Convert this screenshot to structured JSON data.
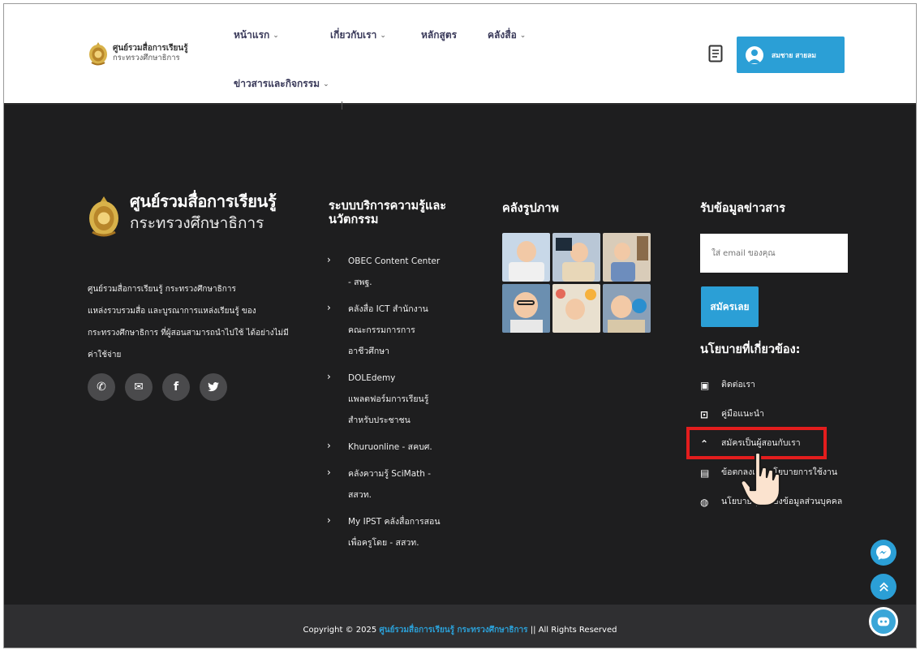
{
  "header": {
    "logo_title": "ศูนย์รวมสื่อการเรียนรู้",
    "logo_sub": "กระทรวงศึกษาธิการ",
    "nav": [
      {
        "label": "หน้าแรก",
        "has_dropdown": true
      },
      {
        "label": "เกี่ยวกับเรา",
        "has_dropdown": true
      },
      {
        "label": "หลักสูตร",
        "has_dropdown": false
      },
      {
        "label": "คลังสื่อ",
        "has_dropdown": true
      },
      {
        "label": "ข่าวสารและกิจกรรม",
        "has_dropdown": true
      }
    ],
    "dropdown_chevron": "⌄",
    "user_name": "สมชาย สายลม"
  },
  "brand": {
    "title": "ศูนย์รวมสื่อการเรียนรู้",
    "sub": "กระทรวงศึกษาธิการ",
    "about_lines": [
      "ศูนย์รวมสื่อการเรียนรู้ กระทรวงศึกษาธิการ",
      "แหล่งรวบรวมสื่อ และบูรณาการแหล่งเรียนรู้ ของ",
      "กระทรวงศึกษาธิการ ที่ผู้สอนสามารถนำไปใช้ ได้อย่างไม่มี",
      "ค่าใช้จ่าย"
    ]
  },
  "social": [
    {
      "icon": "phone-icon",
      "glyph": "✆"
    },
    {
      "icon": "envelope-icon",
      "glyph": "✉"
    },
    {
      "icon": "facebook-icon",
      "glyph": "f"
    },
    {
      "icon": "twitter-icon",
      "glyph": "🐦"
    }
  ],
  "services": {
    "title": "ระบบบริการความรู้และนวัตกรรม",
    "items": [
      [
        "OBEC Content Center",
        "- สพฐ."
      ],
      [
        "คลังสื่อ ICT สำนักงาน",
        "คณะกรรมการการ",
        "อาชีวศึกษา"
      ],
      [
        "DOLEdemy",
        "แพลตฟอร์มการเรียนรู้",
        "สำหรับประชาชน"
      ],
      [
        "Khuruonline - สคบศ."
      ],
      [
        "คลังความรู้ SciMath -",
        "สสวท."
      ],
      [
        "My IPST คลังสื่อการสอน",
        "เพื่อครูโดย - สสวท."
      ]
    ]
  },
  "gallery": {
    "title": "คลังรูปภาพ",
    "colors": [
      "#c8d8e8",
      "#b9c7d6",
      "#d9ccb9",
      "#6b8fb0",
      "#e9e0cf",
      "#8aa0b8"
    ]
  },
  "newsletter": {
    "title": "รับข้อมูลข่าวสาร",
    "placeholder": "ใส่ email ของคุณ",
    "button": "สมัครเลย"
  },
  "policy": {
    "title": "นโยบายที่เกี่ยวข้อง:",
    "items": [
      {
        "label": "ติดต่อเรา",
        "icon": "contact-card-icon",
        "glyph": "▣"
      },
      {
        "label": "คู่มือแนะนำ",
        "icon": "manual-icon",
        "glyph": "⊡"
      },
      {
        "label": "สมัครเป็นผู้สอนกับเรา",
        "icon": "double-chevron-up-icon",
        "glyph": "⌃"
      },
      {
        "label": "ข้อตกลงและนโยบายการใช้งาน",
        "icon": "scroll-icon",
        "glyph": "▤"
      },
      {
        "label": "นโยบายคุ้มครองข้อมูลส่วนบุคคล",
        "icon": "fingerprint-icon",
        "glyph": "◍"
      }
    ]
  },
  "footer": {
    "prefix": "Copyright © 2025",
    "org": "ศูนย์รวมสื่อการเรียนรู้ กระทรวงศึกษาธิการ",
    "suffix": "|| All Rights Reserved"
  },
  "colors": {
    "accent": "#2b9fd6",
    "dark_bg": "#1e1e1f",
    "highlight": "#e31d1d"
  }
}
